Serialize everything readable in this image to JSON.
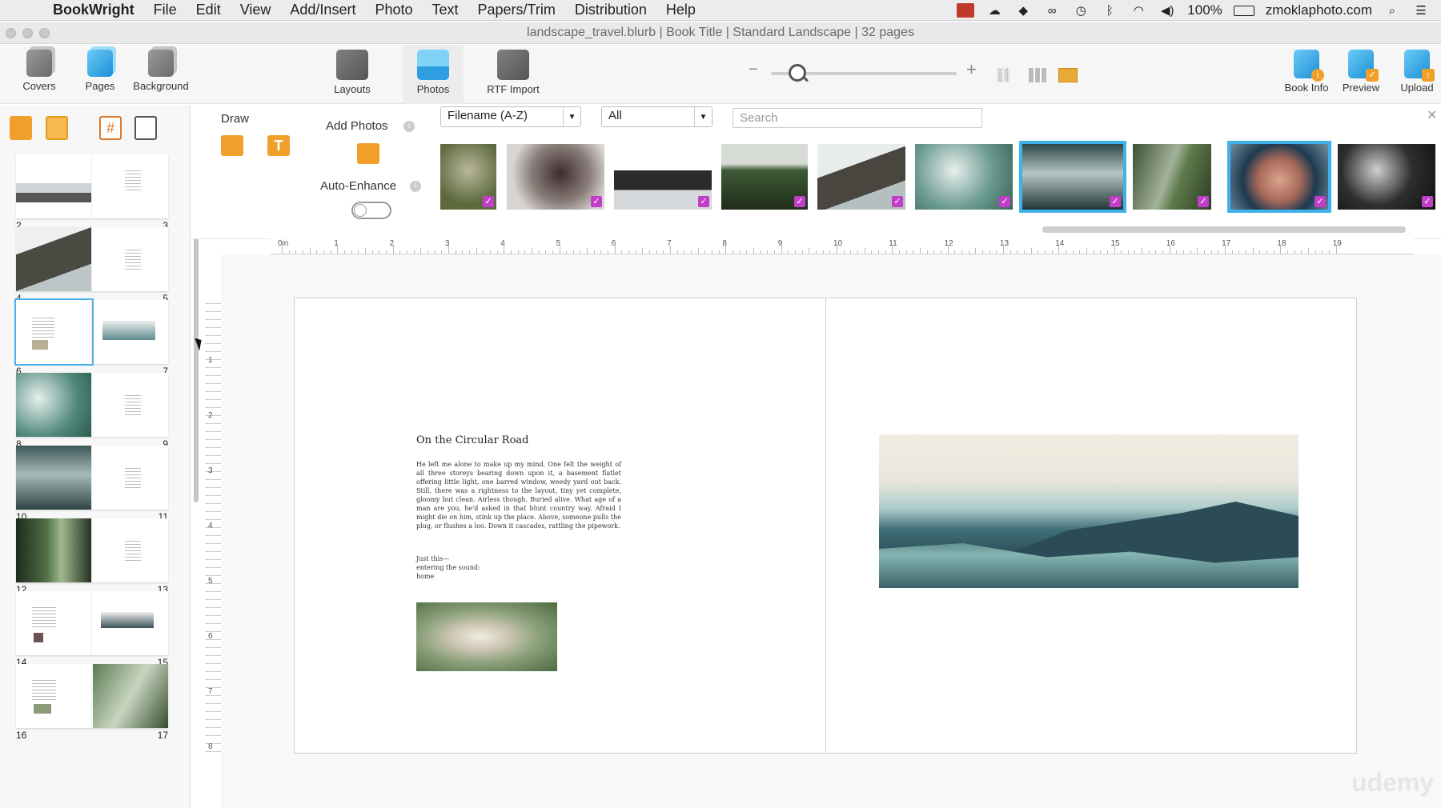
{
  "menubar": {
    "app": "BookWright",
    "items": [
      "File",
      "Edit",
      "View",
      "Add/Insert",
      "Photo",
      "Text",
      "Papers/Trim",
      "Distribution",
      "Help"
    ],
    "battery": "100%",
    "user": "zmoklaphoto.com"
  },
  "window": {
    "title": "landscape_travel.blurb | Book Title | Standard Landscape | 32 pages"
  },
  "toolbar": {
    "covers": "Covers",
    "pages": "Pages",
    "background": "Background",
    "layouts": "Layouts",
    "photos": "Photos",
    "rtf_import": "RTF Import",
    "book_info": "Book Info",
    "preview": "Preview",
    "upload": "Upload",
    "zoom_level": 0.1
  },
  "sidebar": {
    "spreads": [
      {
        "left": "2",
        "right": "3"
      },
      {
        "left": "4",
        "right": "5"
      },
      {
        "left": "6",
        "right": "7",
        "selected_left": true
      },
      {
        "left": "8",
        "right": "9"
      },
      {
        "left": "10",
        "right": "11"
      },
      {
        "left": "12",
        "right": "13"
      },
      {
        "left": "14",
        "right": "15"
      },
      {
        "left": "16",
        "right": "17"
      }
    ]
  },
  "palette": {
    "draw": "Draw",
    "add_photos": "Add Photos",
    "auto_enhance": "Auto-Enhance",
    "sort": "Filename (A-Z)",
    "filter": "All",
    "search_placeholder": "Search"
  },
  "ruler": {
    "zero": "0in",
    "marks": [
      "1",
      "2",
      "3",
      "4",
      "5",
      "6",
      "7",
      "8",
      "9",
      "10",
      "11",
      "12",
      "13",
      "14",
      "15",
      "16",
      "17",
      "18",
      "19"
    ],
    "vmarks": [
      "1",
      "2",
      "3",
      "4",
      "5",
      "6",
      "7",
      "8"
    ]
  },
  "page": {
    "title": "On the Circular Road",
    "body": "He left me alone to make up my mind. One felt the weight of all three storeys bearing down upon it, a basement flatlet offering little light, one barred window, weedy yard out back. Still, there was a rightness to the layout, tiny yet complete, gloomy but clean. Airless though. Buried alive. What age of a man are you, he'd asked in that blunt country way. Afraid I might die on him, stink up the place. Above, someone pulls the plug, or flushes a loo. Down it cascades, rattling the pipework.",
    "poem": "Just this—\nentering the sound:\nhome"
  },
  "watermark": "udemy",
  "colors": {
    "accent": "#3fb2ec",
    "check": "#c13ec9",
    "icon_orange": "#f0a02a"
  }
}
